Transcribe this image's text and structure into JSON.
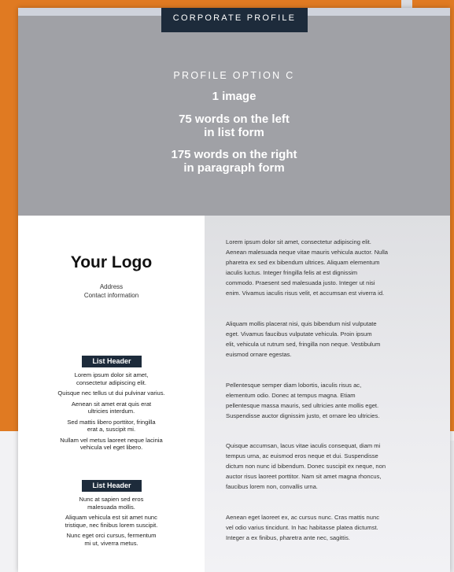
{
  "hero": {
    "tab_label": "CORPORATE PROFILE",
    "option_label": "PROFILE OPTION C",
    "line1": "1 image",
    "line2": "75 words on the left\nin list form",
    "line3": "175 words on the right\nin paragraph form"
  },
  "left": {
    "logo": "Your Logo",
    "address": "Address",
    "contact": "Contact information",
    "list_header_1": "List Header",
    "list1": [
      "Lorem ipsum dolor sit amet,\nconsectetur adipiscing elit.",
      "Quisque nec tellus ut dui pulvinar varius.",
      "Aenean sit amet erat quis erat\nultricies interdum.",
      "Sed mattis libero porttitor, fringilla\nerat a, suscipit mi.",
      "Nullam vel metus laoreet neque lacinia\nvehicula vel eget libero."
    ],
    "list_header_2": "List Header",
    "list2": [
      "Nunc at sapien sed eros\nmalesuada mollis.",
      "Aliquam vehicula est sit amet nunc\ntristique, nec finibus lorem suscipit.",
      "Nunc eget orci cursus, fermentum\nmi ut, viverra metus."
    ]
  },
  "right": {
    "paragraphs": [
      "Lorem ipsum dolor sit amet, consectetur adipiscing elit.\nAenean malesuada neque vitae mauris vehicula auctor. Nulla\npharetra ex sed ex bibendum ultrices. Aliquam elementum\niaculis luctus. Integer fringilla felis at est dignissim\ncommodo. Praesent sed malesuada justo. Integer ut nisi\nenim. Vivamus iaculis risus velit, et accumsan est viverra id.",
      "Aliquam mollis placerat nisi, quis bibendum nisl vulputate\neget. Vivamus faucibus vulputate vehicula. Proin ipsum\nelit, vehicula ut rutrum sed, fringilla non neque. Vestibulum\neuismod ornare egestas.",
      "Pellentesque semper diam lobortis, iaculis risus ac,\nelementum odio. Donec at tempus magna. Etiam\npellentesque massa mauris, sed ultricies ante mollis eget.\nSuspendisse auctor dignissim justo, et ornare leo ultricies.",
      "Quisque accumsan, lacus vitae iaculis consequat, diam mi\ntempus urna, ac euismod eros neque et dui. Suspendisse\ndictum non nunc id bibendum. Donec suscipit ex neque, non\nauctor risus laoreet porttitor. Nam sit amet magna rhoncus,\nfaucibus lorem non, convallis urna.",
      "Aenean eget laoreet ex, ac cursus nunc. Cras mattis nunc\nvel odio varius tincidunt. In hac habitasse platea dictumst.\nInteger a ex finibus, pharetra ante nec, sagittis."
    ]
  }
}
